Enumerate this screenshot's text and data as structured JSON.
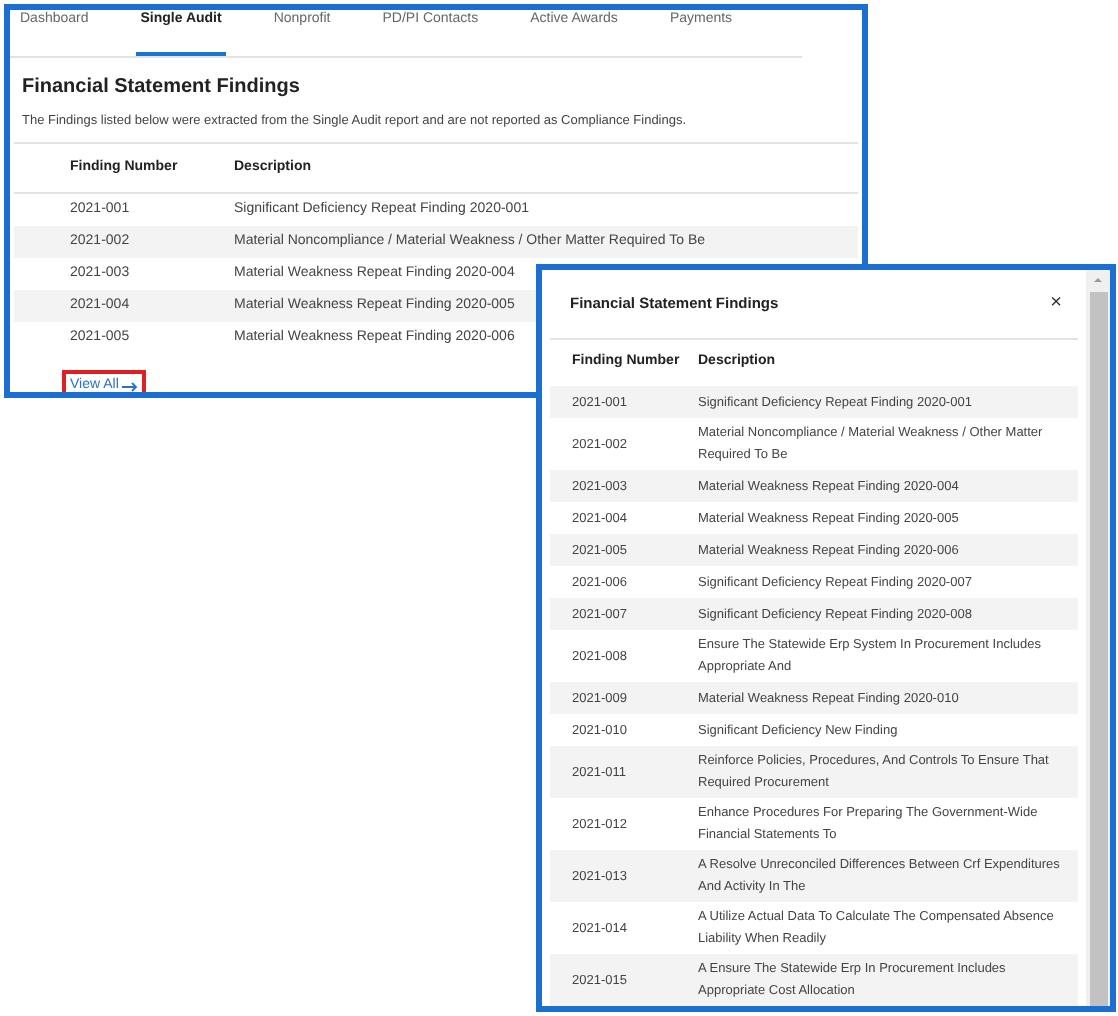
{
  "main_panel": {
    "tabs": [
      {
        "label": "Dashboard",
        "selected": false
      },
      {
        "label": "Single Audit",
        "selected": true
      },
      {
        "label": "Nonprofit",
        "selected": false
      },
      {
        "label": "PD/PI Contacts",
        "selected": false
      },
      {
        "label": "Active Awards",
        "selected": false
      },
      {
        "label": "Payments",
        "selected": false
      }
    ],
    "title": "Financial Statement Findings",
    "description": "The Findings listed below were extracted from the Single Audit report and are not reported as Compliance Findings.",
    "table": {
      "columns": [
        "Finding Number",
        "Description"
      ],
      "rows": [
        [
          "2021-001",
          "Significant Deficiency Repeat Finding 2020-001"
        ],
        [
          "2021-002",
          "Material Noncompliance / Material Weakness / Other Matter Required To Be"
        ],
        [
          "2021-003",
          "Material Weakness Repeat Finding 2020-004"
        ],
        [
          "2021-004",
          "Material Weakness Repeat Finding 2020-005"
        ],
        [
          "2021-005",
          "Material Weakness Repeat Finding 2020-006"
        ]
      ]
    },
    "view_all": {
      "label": "View All",
      "highlighted": true
    }
  },
  "modal": {
    "title": "Financial Statement Findings",
    "close": "×",
    "columns": [
      "Finding Number",
      "Description"
    ],
    "rows": [
      [
        "2021-001",
        "Significant Deficiency Repeat Finding 2020-001"
      ],
      [
        "2021-002",
        "Material Noncompliance / Material Weakness / Other Matter Required To Be"
      ],
      [
        "2021-003",
        "Material Weakness Repeat Finding 2020-004"
      ],
      [
        "2021-004",
        "Material Weakness Repeat Finding 2020-005"
      ],
      [
        "2021-005",
        "Material Weakness Repeat Finding 2020-006"
      ],
      [
        "2021-006",
        "Significant Deficiency Repeat Finding 2020-007"
      ],
      [
        "2021-007",
        "Significant Deficiency Repeat Finding 2020-008"
      ],
      [
        "2021-008",
        "Ensure The Statewide Erp System In Procurement Includes Appropriate And"
      ],
      [
        "2021-009",
        "Material Weakness Repeat Finding 2020-010"
      ],
      [
        "2021-010",
        "Significant Deficiency New Finding"
      ],
      [
        "2021-011",
        "Reinforce Policies, Procedures, And Controls To Ensure That Required Procurement"
      ],
      [
        "2021-012",
        "Enhance Procedures For Preparing The Government-Wide Financial Statements To"
      ],
      [
        "2021-013",
        "A Resolve Unreconciled Differences Between Crf Expenditures And Activity In The"
      ],
      [
        "2021-014",
        "A Utilize Actual Data To Calculate The Compensated Absence Liability When Readily"
      ],
      [
        "2021-015",
        "A Ensure The Statewide Erp In Procurement Includes Appropriate Cost Allocation"
      ]
    ]
  }
}
